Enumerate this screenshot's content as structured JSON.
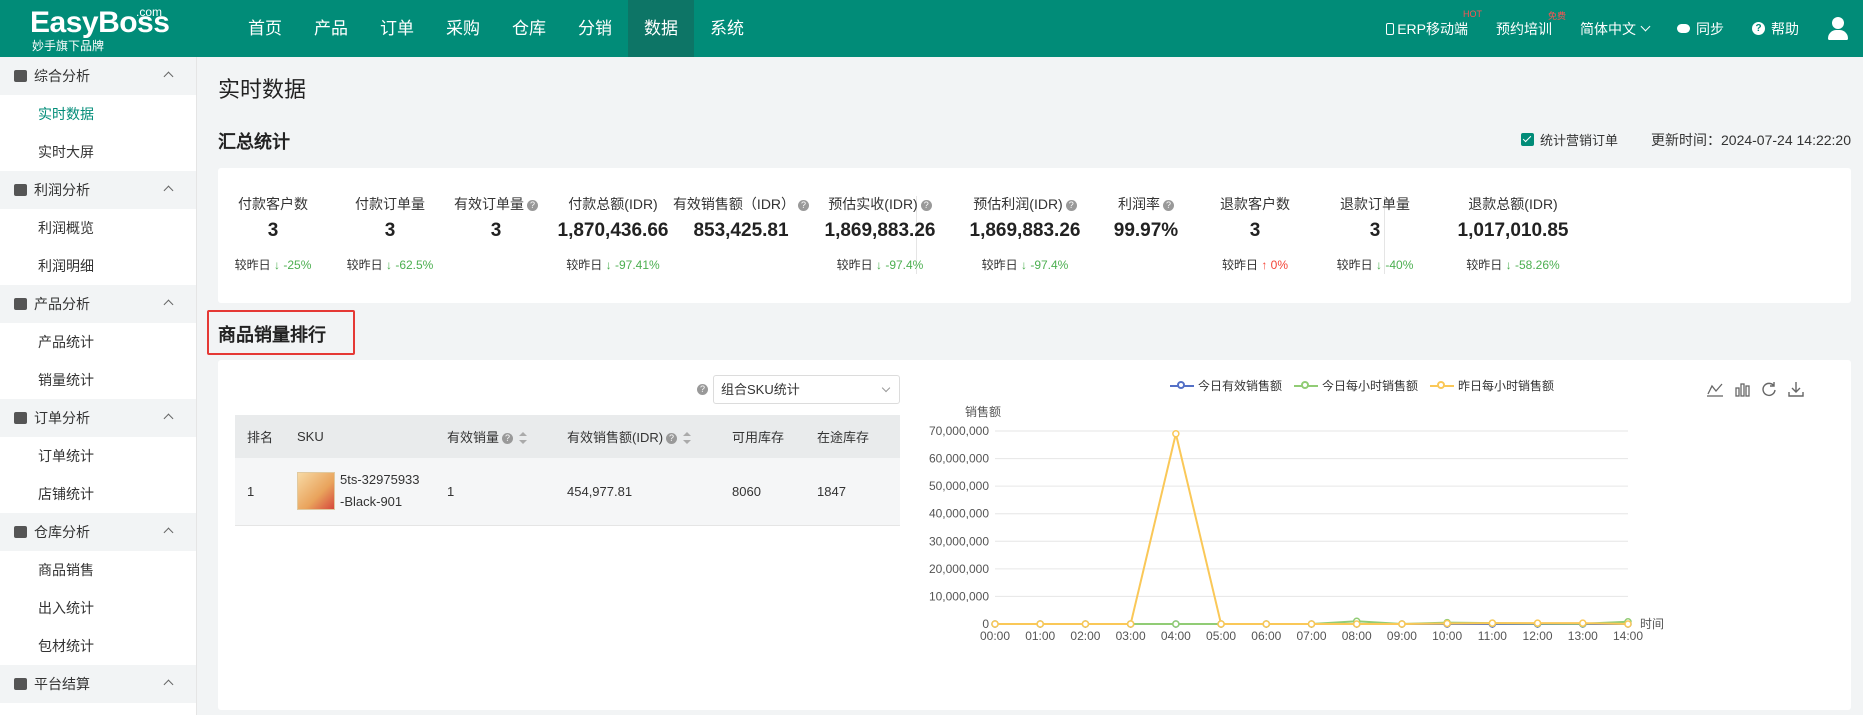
{
  "logo": {
    "brand": "EasyBoss",
    "com": ".com",
    "sub": "妙手旗下品牌"
  },
  "nav": [
    "首页",
    "产品",
    "订单",
    "采购",
    "仓库",
    "分销",
    "数据",
    "系统"
  ],
  "nav_active_index": 6,
  "topright": {
    "mobile": "ERP移动端",
    "mobile_tag": "HOT",
    "training": "预约培训",
    "training_tag": "免费",
    "lang": "简体中文",
    "sync": "同步",
    "help": "帮助"
  },
  "sidebar": [
    {
      "group": "综合分析",
      "items": [
        "实时数据",
        "实时大屏"
      ]
    },
    {
      "group": "利润分析",
      "items": [
        "利润概览",
        "利润明细"
      ]
    },
    {
      "group": "产品分析",
      "items": [
        "产品统计",
        "销量统计"
      ]
    },
    {
      "group": "订单分析",
      "items": [
        "订单统计",
        "店铺统计"
      ]
    },
    {
      "group": "仓库分析",
      "items": [
        "商品销售",
        "出入统计",
        "包材统计"
      ]
    },
    {
      "group": "平台结算",
      "items": []
    }
  ],
  "sidebar_active": "实时数据",
  "page_title": "实时数据",
  "summary": {
    "title": "汇总统计",
    "checkbox_label": "统计营销订单",
    "update_time": "更新时间：2024-07-24 14:22:20",
    "compare_prefix": "较昨日",
    "stats": [
      {
        "label": "付款客户数",
        "value": "3",
        "change": "-25%",
        "dir": "down",
        "help": false
      },
      {
        "label": "付款订单量",
        "value": "3",
        "change": "-62.5%",
        "dir": "down",
        "help": false
      },
      {
        "label": "有效订单量",
        "value": "3",
        "change": "",
        "dir": "",
        "help": true
      },
      {
        "label": "付款总额(IDR)",
        "value": "1,870,436.66",
        "change": "-97.41%",
        "dir": "down",
        "help": false
      },
      {
        "label": "有效销售额（IDR）",
        "value": "853,425.81",
        "change": "",
        "dir": "",
        "help": true
      },
      {
        "label": "预估实收(IDR)",
        "value": "1,869,883.26",
        "change": "-97.4%",
        "dir": "down",
        "help": true
      },
      {
        "label": "预估利润(IDR)",
        "value": "1,869,883.26",
        "change": "-97.4%",
        "dir": "down",
        "help": true
      },
      {
        "label": "利润率",
        "value": "99.97%",
        "change": "",
        "dir": "",
        "help": true
      },
      {
        "label": "退款客户数",
        "value": "3",
        "change": "0%",
        "dir": "up",
        "help": false
      },
      {
        "label": "退款订单量",
        "value": "3",
        "change": "-40%",
        "dir": "down",
        "help": false
      },
      {
        "label": "退款总额(IDR)",
        "value": "1,017,010.85",
        "change": "-58.26%",
        "dir": "down",
        "help": false
      }
    ]
  },
  "ranking": {
    "title": "商品销量排行",
    "select_value": "组合SKU统计",
    "columns": [
      "排名",
      "SKU",
      "有效销量",
      "有效销售额(IDR)",
      "可用库存",
      "在途库存"
    ],
    "rows": [
      {
        "rank": "1",
        "sku": "5ts-32975933-Black-901",
        "qty": "1",
        "amount": "454,977.81",
        "stock": "8060",
        "transit": "1847"
      }
    ]
  },
  "colors": {
    "primary": "#018c78",
    "nav_active": "#0d7566",
    "series_today": "#5470c6",
    "series_hourly": "#91cc75",
    "series_yesterday": "#fac858"
  },
  "chart_data": {
    "type": "line",
    "ylabel": "销售额",
    "xlabel": "时间",
    "x": [
      "00:00",
      "01:00",
      "02:00",
      "03:00",
      "04:00",
      "05:00",
      "06:00",
      "07:00",
      "08:00",
      "09:00",
      "10:00",
      "11:00",
      "12:00",
      "13:00",
      "14:00"
    ],
    "yticks": [
      "0",
      "10,000,000",
      "20,000,000",
      "30,000,000",
      "40,000,000",
      "50,000,000",
      "60,000,000",
      "70,000,000"
    ],
    "ylim": [
      0,
      70000000
    ],
    "legend_position": "top-center",
    "series": [
      {
        "name": "今日有效销售额",
        "values": [
          0,
          0,
          0,
          0,
          0,
          0,
          0,
          0,
          0,
          0,
          0,
          0,
          0,
          0,
          0
        ]
      },
      {
        "name": "今日每小时销售额",
        "values": [
          0,
          0,
          0,
          0,
          0,
          0,
          0,
          0,
          1000000,
          0,
          500000,
          300000,
          200000,
          100000,
          800000
        ]
      },
      {
        "name": "昨日每小时销售额",
        "values": [
          0,
          0,
          0,
          0,
          69000000,
          0,
          0,
          0,
          0,
          0,
          200000,
          300000,
          300000,
          300000,
          0
        ]
      }
    ]
  }
}
